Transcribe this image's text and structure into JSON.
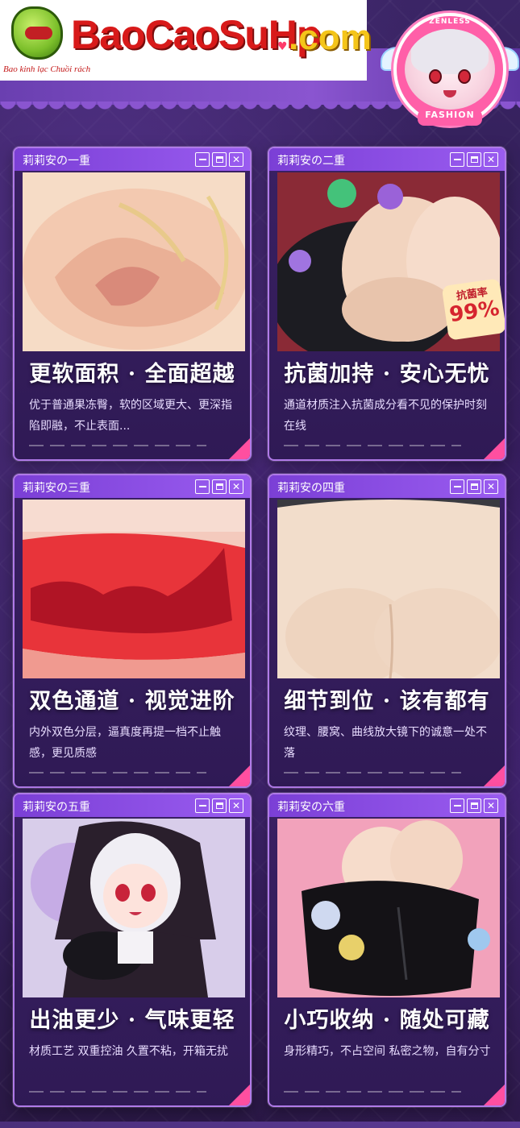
{
  "header": {
    "logo_text": "BaoCaoSuHp",
    "logo_tld": ".com",
    "slogan": "Bao kinh lạc Chuồi rách",
    "badge_top": "ZENLESS",
    "badge_bottom": "FASHION"
  },
  "cards": [
    {
      "title": "莉莉安の一重",
      "headline": "更软面积 · 全面超越",
      "desc": "优于普通果冻臀，软的区域更大、更深指陷即融，不止表面..."
    },
    {
      "title": "莉莉安の二重",
      "headline": "抗菌加持 · 安心无忧",
      "desc": "通道材质注入抗菌成分看不见的保护时刻在线",
      "sticker_label": "抗菌率",
      "sticker_value": "99%"
    },
    {
      "title": "莉莉安の三重",
      "headline": "双色通道 · 视觉进阶",
      "desc": "内外双色分层，逼真度再提一档不止触感，更见质感"
    },
    {
      "title": "莉莉安の四重",
      "headline": "细节到位 · 该有都有",
      "desc": "纹理、腰窝、曲线放大镜下的诚意一处不落"
    },
    {
      "title": "莉莉安の五重",
      "headline": "出油更少 · 气味更轻",
      "desc": "材质工艺 双重控油 久置不粘，开箱无扰"
    },
    {
      "title": "莉莉安の六重",
      "headline": "小巧收纳 · 随处可藏",
      "desc": "身形精巧，不占空间 私密之物，自有分寸"
    }
  ],
  "colors": {
    "titlebar": "#8a4de6",
    "accent_pink": "#ff4fa0",
    "card_bg": "#34205c"
  }
}
